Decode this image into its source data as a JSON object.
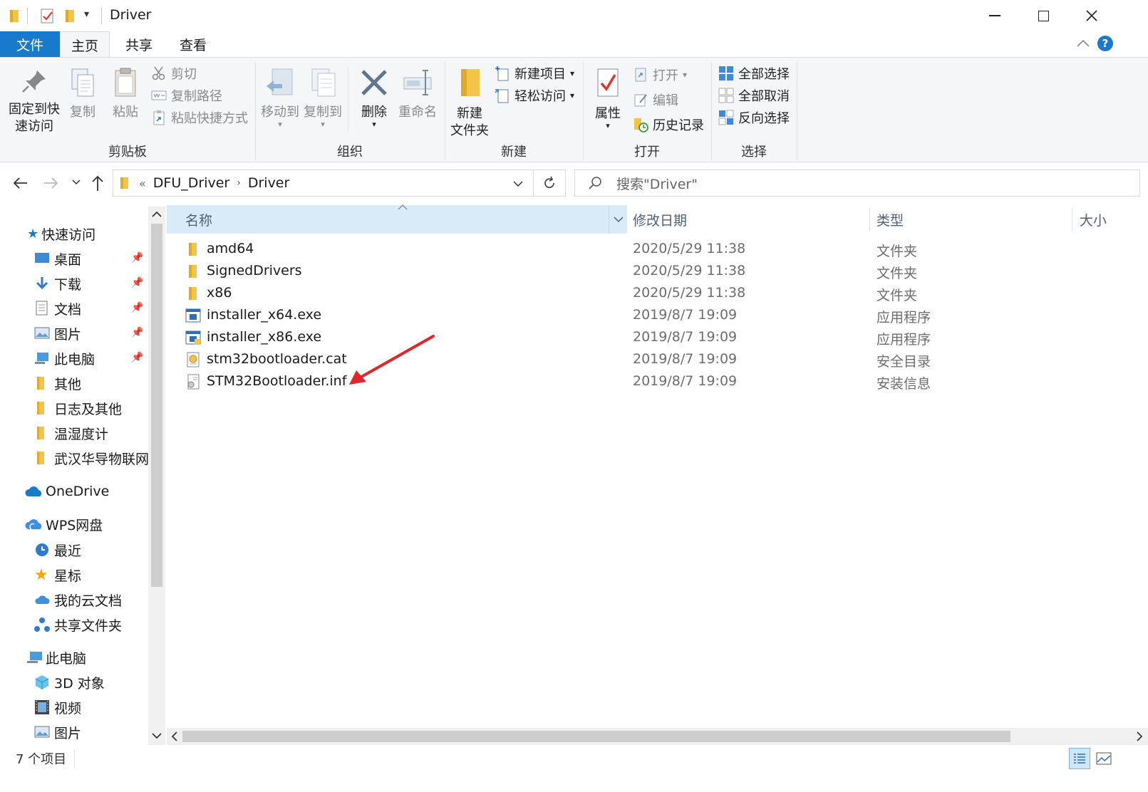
{
  "window": {
    "title": "Driver"
  },
  "tabs": [
    {
      "label": "文件",
      "active": true
    },
    {
      "label": "主页"
    },
    {
      "label": "共享"
    },
    {
      "label": "查看"
    }
  ],
  "ribbon": {
    "clipboard": {
      "group_label": "剪贴板",
      "pin": "固定到快速访问",
      "pin_line1": "固定到快",
      "pin_line2": "速访问",
      "copy": "复制",
      "paste": "粘贴",
      "cut": "剪切",
      "copy_path": "复制路径",
      "paste_shortcut": "粘贴快捷方式"
    },
    "organize": {
      "group_label": "组织",
      "move_to": "移动到",
      "copy_to": "复制到",
      "delete": "删除",
      "rename": "重命名"
    },
    "new": {
      "group_label": "新建",
      "new_folder_line1": "新建",
      "new_folder_line2": "文件夹",
      "new_item": "新建项目",
      "easy_access": "轻松访问"
    },
    "open": {
      "group_label": "打开",
      "properties": "属性",
      "open": "打开",
      "edit": "编辑",
      "history": "历史记录"
    },
    "select": {
      "group_label": "选择",
      "select_all": "全部选择",
      "select_none": "全部取消",
      "invert": "反向选择"
    }
  },
  "address": {
    "overflow": "«",
    "path": [
      "DFU_Driver",
      "Driver"
    ],
    "search_placeholder": "搜索\"Driver\""
  },
  "sidebar": {
    "quick_access": "快速访问",
    "quick_items": [
      {
        "label": "桌面",
        "icon": "desktop-icon",
        "pinned": true
      },
      {
        "label": "下载",
        "icon": "download-icon",
        "pinned": true
      },
      {
        "label": "文档",
        "icon": "document-icon",
        "pinned": true
      },
      {
        "label": "图片",
        "icon": "pictures-icon",
        "pinned": true
      },
      {
        "label": "此电脑",
        "icon": "computer-icon",
        "pinned": true
      },
      {
        "label": "其他",
        "icon": "folder-icon"
      },
      {
        "label": "日志及其他",
        "icon": "folder-icon"
      },
      {
        "label": "温湿度计",
        "icon": "folder-icon"
      },
      {
        "label": "武汉华导物联网",
        "icon": "folder-icon"
      }
    ],
    "onedrive": "OneDrive",
    "wps": "WPS网盘",
    "wps_items": [
      {
        "label": "最近",
        "icon": "clock-icon"
      },
      {
        "label": "星标",
        "icon": "star-icon"
      },
      {
        "label": "我的云文档",
        "icon": "cloud-icon"
      },
      {
        "label": "共享文件夹",
        "icon": "share-icon"
      }
    ],
    "this_pc": "此电脑",
    "pc_items": [
      {
        "label": "3D 对象",
        "icon": "cube-icon"
      },
      {
        "label": "视频",
        "icon": "video-icon"
      },
      {
        "label": "图片",
        "icon": "pictures-icon"
      }
    ]
  },
  "columns": {
    "name": "名称",
    "date": "修改日期",
    "type": "类型",
    "size": "大小"
  },
  "files": [
    {
      "name": "amd64",
      "date": "2020/5/29 11:38",
      "type": "文件夹",
      "icon": "folder-icon"
    },
    {
      "name": "SignedDrivers",
      "date": "2020/5/29 11:38",
      "type": "文件夹",
      "icon": "folder-icon"
    },
    {
      "name": "x86",
      "date": "2020/5/29 11:38",
      "type": "文件夹",
      "icon": "folder-icon"
    },
    {
      "name": "installer_x64.exe",
      "date": "2019/8/7 19:09",
      "type": "应用程序",
      "icon": "exe-icon"
    },
    {
      "name": "installer_x86.exe",
      "date": "2019/8/7 19:09",
      "type": "应用程序",
      "icon": "exe-icon"
    },
    {
      "name": "stm32bootloader.cat",
      "date": "2019/8/7 19:09",
      "type": "安全目录",
      "icon": "catalog-icon"
    },
    {
      "name": "STM32Bootloader.inf",
      "date": "2019/8/7 19:09",
      "type": "安装信息",
      "icon": "inf-icon"
    }
  ],
  "status": {
    "count": "7 个项目"
  },
  "colors": {
    "accent": "#1979ca",
    "folder": "#f2c54a",
    "header_hover": "#d9ebf9",
    "arrow": "#e0262a"
  }
}
